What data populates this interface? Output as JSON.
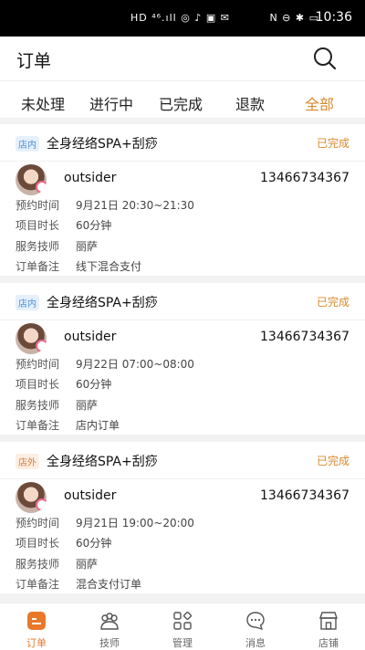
{
  "statusbar": {
    "left_icons": "HD ⁴⁶.ıll  ◎ ♪ ▣ ✉",
    "right_icons": "N ⊖ ✱ ▭",
    "time": "10:36"
  },
  "header": {
    "title": "订单"
  },
  "tabs": [
    "未处理",
    "进行中",
    "已完成",
    "退款",
    "全部"
  ],
  "orders": [
    {
      "tag": "店内",
      "service": "全身经络SPA+刮痧",
      "status": "已完成",
      "user": "outsider",
      "phone": "13466734367",
      "rows": [
        {
          "label": "预约时间",
          "value": "9月21日  20:30~21:30"
        },
        {
          "label": "项目时长",
          "value": "60分钟"
        },
        {
          "label": "服务技师",
          "value": "丽萨"
        },
        {
          "label": "订单备注",
          "value": "线下混合支付"
        }
      ]
    },
    {
      "tag": "店内",
      "service": "全身经络SPA+刮痧",
      "status": "已完成",
      "user": "outsider",
      "phone": "13466734367",
      "rows": [
        {
          "label": "预约时间",
          "value": "9月22日  07:00~08:00"
        },
        {
          "label": "项目时长",
          "value": "60分钟"
        },
        {
          "label": "服务技师",
          "value": "丽萨"
        },
        {
          "label": "订单备注",
          "value": "店内订单"
        }
      ]
    },
    {
      "tag": "店外",
      "service": "全身经络SPA+刮痧",
      "status": "已完成",
      "user": "outsider",
      "phone": "13466734367",
      "rows": [
        {
          "label": "预约时间",
          "value": "9月21日  19:00~20:00"
        },
        {
          "label": "项目时长",
          "value": "60分钟"
        },
        {
          "label": "服务技师",
          "value": "丽萨"
        },
        {
          "label": "订单备注",
          "value": "混合支付订单"
        }
      ]
    }
  ],
  "bottomnav": [
    {
      "label": "订单",
      "icon": "order-icon"
    },
    {
      "label": "技师",
      "icon": "technician-icon"
    },
    {
      "label": "管理",
      "icon": "manage-icon"
    },
    {
      "label": "消息",
      "icon": "message-icon"
    },
    {
      "label": "店铺",
      "icon": "store-icon"
    }
  ],
  "colors": {
    "accent": "#e8782a",
    "status": "#d88a2e",
    "tag_in": "#4a90d9",
    "tag_out": "#e07a3a"
  }
}
